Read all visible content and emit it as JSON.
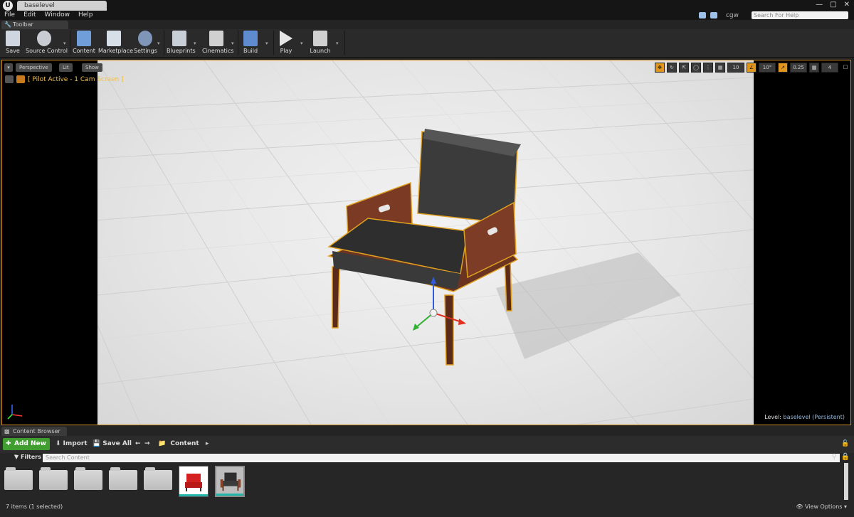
{
  "app": {
    "logo": "U",
    "document_tab": "baselevel"
  },
  "menu": [
    "File",
    "Edit",
    "Window",
    "Help"
  ],
  "user": "cgw",
  "search_help_placeholder": "Search For Help",
  "toolbar_tab": "Toolbar",
  "toolbar": [
    {
      "label": "Save",
      "icon": "save-icon",
      "color": "#cfd6df"
    },
    {
      "label": "Source Control",
      "icon": "source-control-icon",
      "color": "#c9cdd3"
    },
    {
      "label": "Content",
      "icon": "content-icon",
      "color": "#6f9ed8"
    },
    {
      "label": "Marketplace",
      "icon": "marketplace-icon",
      "color": "#d7dfe8"
    },
    {
      "label": "Settings",
      "icon": "settings-icon",
      "color": "#7f96b8"
    },
    {
      "label": "Blueprints",
      "icon": "blueprints-icon",
      "color": "#c8ced6"
    },
    {
      "label": "Cinematics",
      "icon": "cinematics-icon",
      "color": "#d0d0d0"
    },
    {
      "label": "Build",
      "icon": "build-icon",
      "color": "#5f8bd1"
    },
    {
      "label": "Play",
      "icon": "play-icon",
      "color": "#e6e6e6"
    },
    {
      "label": "Launch",
      "icon": "launch-icon",
      "color": "#d0d0d0"
    }
  ],
  "viewport": {
    "chips": [
      "Perspective",
      "Lit",
      "Show"
    ],
    "pilot_text": "[ Pilot Active - 1 Cam Screen ]",
    "right_tools": [
      "10",
      "10°",
      "0.25",
      "4"
    ],
    "level_label": "Level:",
    "level_value": "baselevel (Persistent)"
  },
  "content_browser": {
    "tab": "Content Browser",
    "add_new": "Add New",
    "import": "Import",
    "save_all": "Save All",
    "path": "Content",
    "filters": "Filters",
    "search_placeholder": "Search Content",
    "status": "7 items (1 selected)",
    "view_options": "View Options"
  },
  "colors": {
    "accent_selection": "#c88b1e",
    "add_new_green": "#3f9e2f",
    "asset_stripe": "#23b5a7"
  }
}
